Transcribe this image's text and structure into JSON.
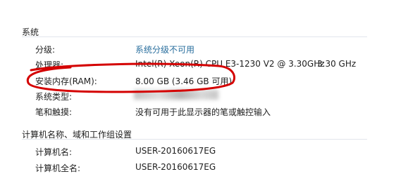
{
  "system": {
    "title": "系统",
    "rating_label": "分级:",
    "rating_value": "系统分级不可用",
    "processor_label": "处理器:",
    "processor_value": "Intel(R) Xeon(R) CPU E3-1230 V2 @ 3.30GHz",
    "processor_speed": "3.30 GHz",
    "ram_label": "安装内存(RAM):",
    "ram_value": "8.00 GB (3.46 GB 可用)",
    "system_type_label": "系统类型:",
    "pen_touch_label": "笔和触摸:",
    "pen_touch_value": "没有可用于此显示器的笔或触控输入"
  },
  "computer": {
    "title": "计算机名称、域和工作组设置",
    "name_label": "计算机名:",
    "name_value": "USER-20160617EG",
    "full_name_label": "计算机全名:",
    "full_name_value": "USER-20160617EG"
  },
  "colors": {
    "annotation": "#d40000",
    "link": "#2a6f9e"
  }
}
